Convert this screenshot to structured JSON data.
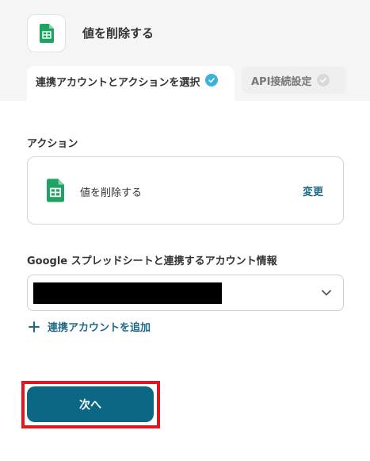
{
  "header": {
    "title": "値を削除する",
    "app_icon": "google-sheets-icon"
  },
  "tabs": [
    {
      "label": "連携アカウントとアクションを選択",
      "state": "active",
      "icon": "check-circle-icon",
      "color": "#3bb2d8"
    },
    {
      "label": "API接続設定",
      "state": "inactive",
      "icon": "check-circle-icon",
      "color": "#d9d9d9"
    }
  ],
  "action_section": {
    "label": "アクション",
    "card_text": "値を削除する",
    "change_label": "変更"
  },
  "account_section": {
    "label": "Google スプレッドシートと連携するアカウント情報",
    "add_label": "連携アカウントを追加"
  },
  "next_button": {
    "label": "次へ",
    "color": "#0b6783"
  },
  "colors": {
    "link": "#1d6a87",
    "highlight": "#e3161e",
    "sheets_green": "#1ea362"
  }
}
